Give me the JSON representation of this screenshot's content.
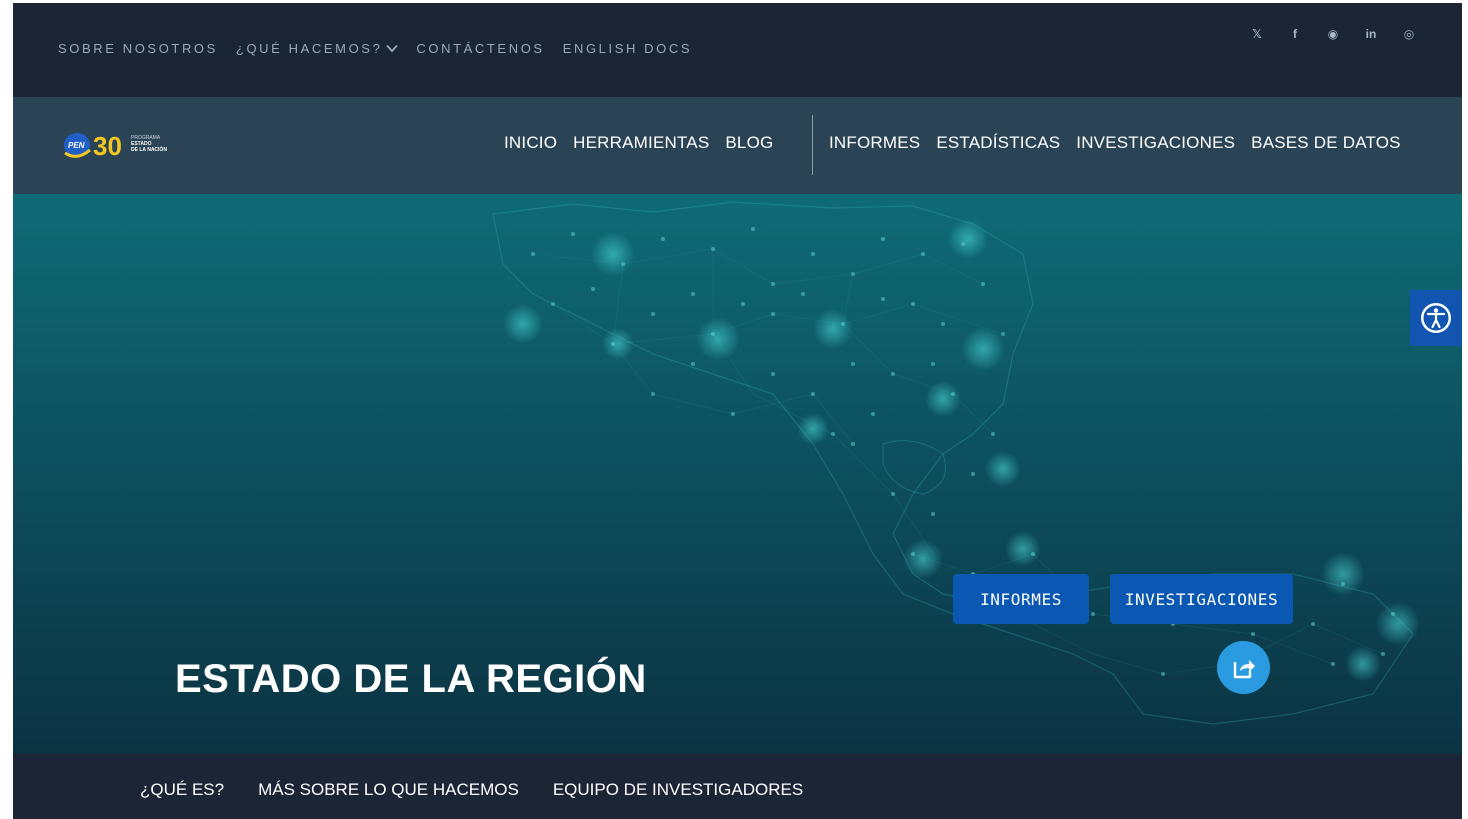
{
  "topbar": {
    "links": [
      "SOBRE NOSOTROS",
      "¿QUÉ HACEMOS?",
      "CONTÁCTENOS",
      "ENGLISH DOCS"
    ],
    "social": [
      "x-icon",
      "facebook-icon",
      "spotify-icon",
      "linkedin-icon",
      "instagram-icon"
    ],
    "social_glyphs": {
      "x": "𝕏",
      "facebook": "f",
      "spotify": "◉",
      "linkedin": "in",
      "instagram": "◎"
    }
  },
  "logo": {
    "pen": "PEN",
    "number": "30",
    "line1": "PROGRAMA",
    "line2": "ESTADO",
    "line3": "DE LA NACIÓN"
  },
  "mainnav": {
    "left": [
      "INICIO",
      "HERRAMIENTAS",
      "BLOG"
    ],
    "right": [
      "INFORMES",
      "ESTADÍSTICAS",
      "INVESTIGACIONES",
      "BASES DE DATOS"
    ]
  },
  "hero": {
    "title": "ESTADO DE LA REGIÓN",
    "button_informes": "INFORMES",
    "button_investigaciones": "INVESTIGACIONES"
  },
  "subnav": {
    "items": [
      "¿QUÉ ES?",
      "MÁS SOBRE LO QUE HACEMOS",
      "EQUIPO DE INVESTIGADORES"
    ]
  },
  "colors": {
    "topbar_bg": "#1b2535",
    "mainnav_bg": "#2b4455",
    "button_bg": "#0a58b4",
    "share_bg": "#2a9be0",
    "accessibility_bg": "#1155b0"
  }
}
